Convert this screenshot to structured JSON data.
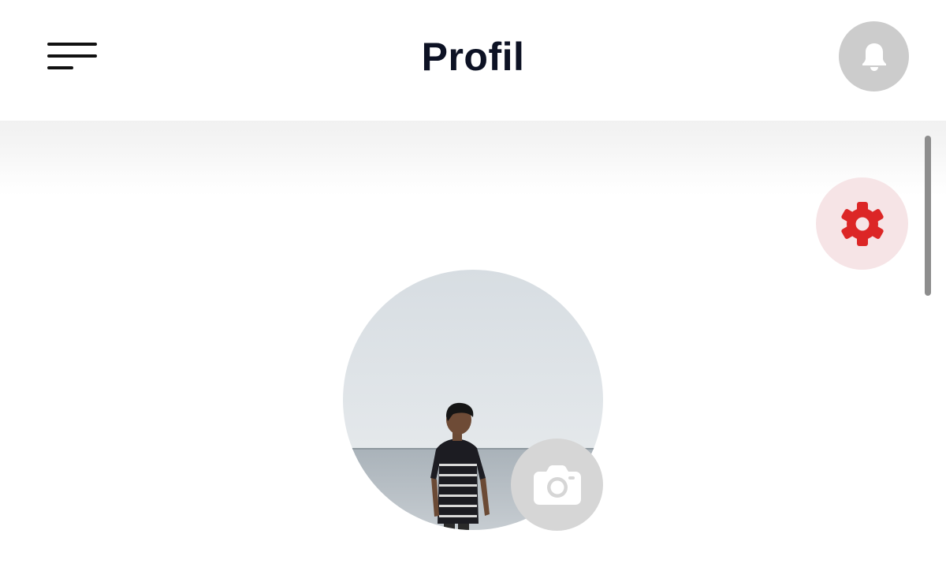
{
  "header": {
    "title": "Profil",
    "menu_icon": "hamburger-menu-icon",
    "notification_icon": "bell-icon"
  },
  "actions": {
    "settings_icon": "gear-icon",
    "settings_color": "#dc2626",
    "settings_background": "#f6e4e6"
  },
  "profile": {
    "avatar": "profile-photo",
    "change_photo_icon": "camera-icon"
  },
  "colors": {
    "title": "#0d1224",
    "bell_background": "#cccccc",
    "camera_background": "#d6d6d6"
  }
}
